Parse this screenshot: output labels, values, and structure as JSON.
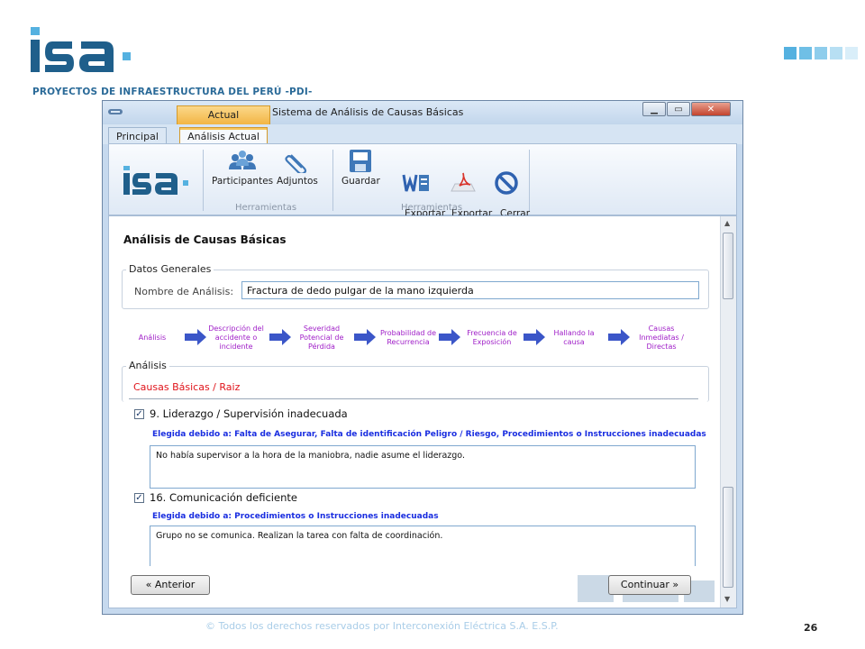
{
  "slide": {
    "subtitle": "PROYECTOS DE INFRAESTRUCTURA DEL PERÚ -PDI-",
    "footer": "© Todos los derechos reservados por Interconexión Eléctrica S.A. E.S.P.",
    "page_number": "26",
    "accent_colors": [
      "#2a6a98",
      "#55b1e0",
      "#a9cde8"
    ]
  },
  "window": {
    "context_tab": "Actual",
    "title": "Sistema de Análisis de Causas Básicas",
    "tabs": [
      {
        "label": "Principal"
      },
      {
        "label": "Análisis Actual"
      }
    ],
    "ribbon": {
      "buttons": [
        {
          "label": "Participantes",
          "icon": "participants-icon"
        },
        {
          "label": "Adjuntos",
          "icon": "paperclip-icon"
        },
        {
          "label": "Guardar",
          "icon": "save-icon"
        },
        {
          "label": "Exportar\na Word",
          "icon": "word-icon"
        },
        {
          "label": "Exportar\na PDF",
          "icon": "pdf-icon"
        },
        {
          "label": "Cerrar\nAnálisis",
          "icon": "close-analysis-icon"
        }
      ],
      "groups": [
        {
          "label": "Herramientas"
        },
        {
          "label": "Herramientas"
        }
      ]
    }
  },
  "main": {
    "section_title": "Análisis de Causas Básicas",
    "datos_generales": {
      "legend": "Datos Generales",
      "field_label": "Nombre de Análisis:",
      "field_value": "Fractura de dedo pulgar de la mano izquierda"
    },
    "steps": [
      {
        "label": "Análisis"
      },
      {
        "label": "Descripción del\naccidente o\nincidente"
      },
      {
        "label": "Severidad\nPotencial de\nPérdida"
      },
      {
        "label": "Probabilidad de\nRecurrencia"
      },
      {
        "label": "Frecuencia de\nExposición"
      },
      {
        "label": "Hallando la\ncausa"
      },
      {
        "label": "Causas\nInmediatas /\nDirectas"
      }
    ],
    "analisis": {
      "legend": "Análisis",
      "category": "Causas Básicas / Raiz",
      "items": [
        {
          "checked": true,
          "title": "9. Liderazgo / Supervisión inadecuada",
          "reason": "Elegida debido a: Falta de Asegurar, Falta de identificación Peligro / Riesgo, Procedimientos o Instrucciones inadecuadas",
          "comment": "No había supervisor a la hora de la maniobra, nadie asume el liderazgo."
        },
        {
          "checked": true,
          "title": "16. Comunicación deficiente",
          "reason": "Elegida debido a: Procedimientos o Instrucciones inadecuadas",
          "comment": "Grupo no se comunica. Realizan la tarea con falta de coordinación."
        }
      ]
    },
    "nav": {
      "prev": "« Anterior",
      "next": "Continuar »"
    }
  }
}
